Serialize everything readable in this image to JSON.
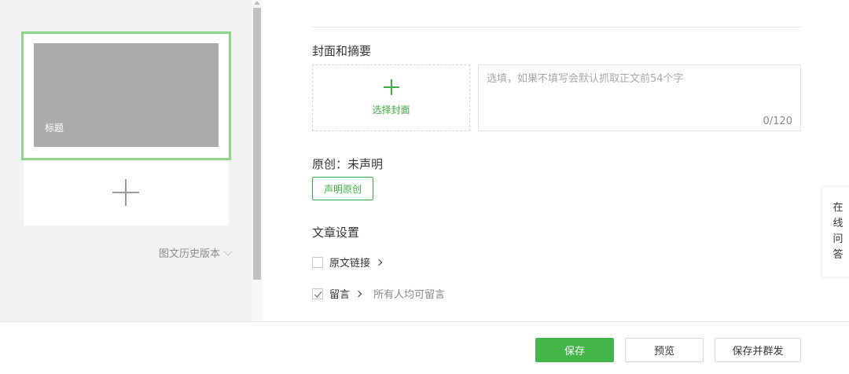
{
  "sidebar": {
    "article_title": "标题",
    "history_label": "图文历史版本"
  },
  "cover": {
    "section_label": "封面和摘要",
    "choose_label": "选择封面",
    "summary_placeholder": "选填，如果不填写会默认抓取正文前54个字",
    "summary_value": "",
    "counter": "0/120"
  },
  "original": {
    "status_label": "原创：未声明",
    "declare_button": "声明原创"
  },
  "settings": {
    "section_label": "文章设置",
    "source_link_label": "原文链接",
    "source_link_checked": false,
    "comment_label": "留言",
    "comment_checked": true,
    "comment_hint": "所有人均可留言"
  },
  "side_tab": [
    "在",
    "线",
    "问",
    "答"
  ],
  "footer": {
    "save": "保存",
    "preview": "预览",
    "save_and_mass_send": "保存并群发"
  },
  "colors": {
    "accent": "#44b549",
    "selected_border": "#8dd58a",
    "thumb_placeholder": "#ababab"
  }
}
